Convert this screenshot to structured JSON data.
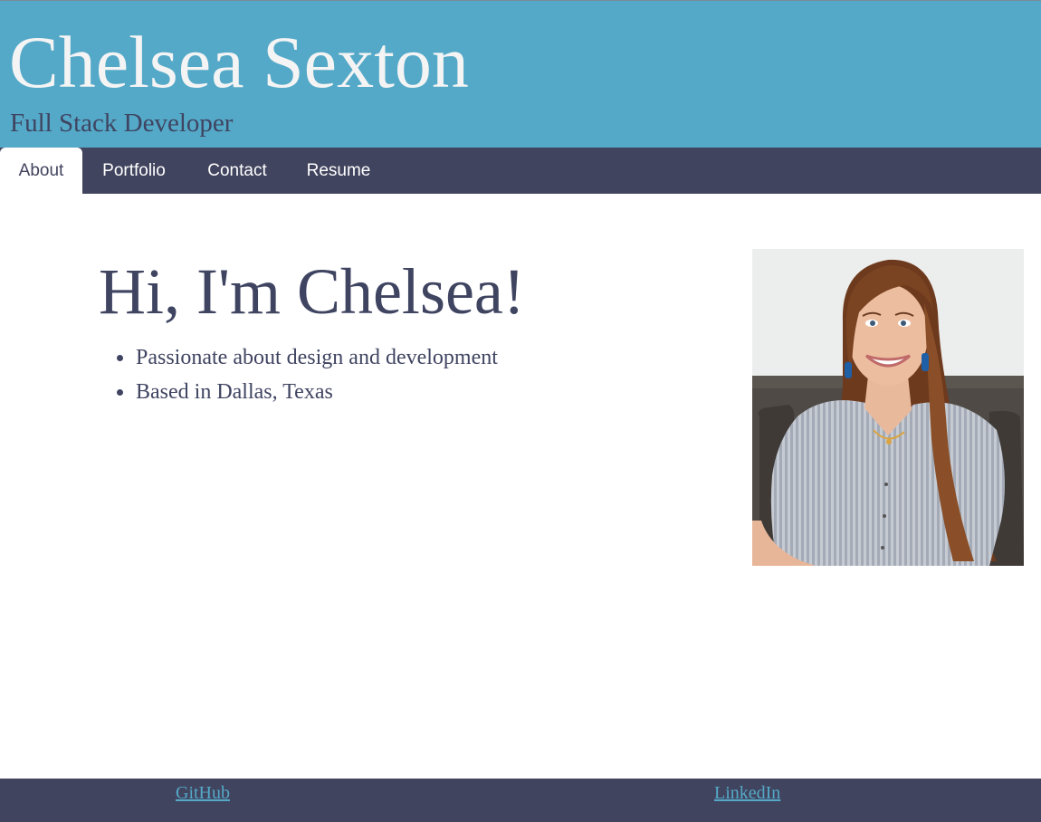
{
  "header": {
    "title": "Chelsea Sexton",
    "subtitle": "Full Stack Developer"
  },
  "nav": {
    "tabs": [
      {
        "label": "About",
        "active": true
      },
      {
        "label": "Portfolio",
        "active": false
      },
      {
        "label": "Contact",
        "active": false
      },
      {
        "label": "Resume",
        "active": false
      }
    ]
  },
  "about": {
    "heading": "Hi, I'm Chelsea!",
    "bullets": [
      "Passionate about design and development",
      "Based in Dallas, Texas"
    ]
  },
  "footer": {
    "links": [
      {
        "label": "GitHub"
      },
      {
        "label": "LinkedIn"
      }
    ]
  },
  "colors": {
    "header_bg": "#54a9c8",
    "nav_bg": "#41445e",
    "text_dark": "#3f4461",
    "link": "#54a9c8"
  }
}
